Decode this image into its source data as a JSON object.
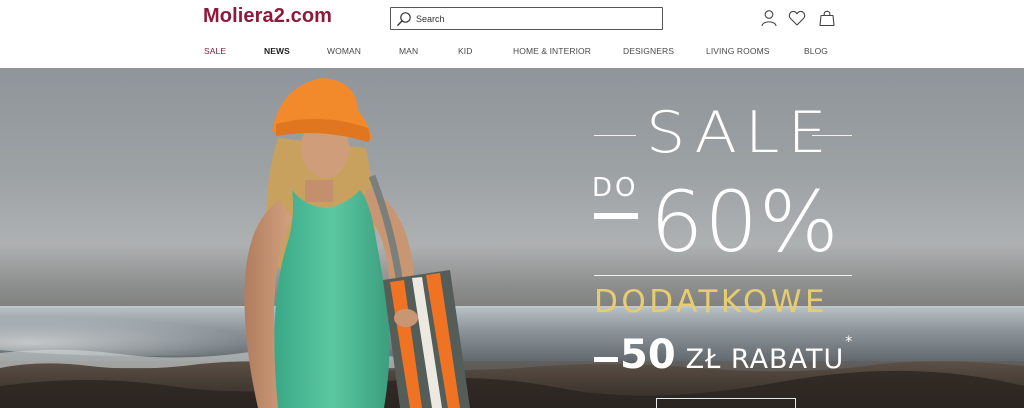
{
  "header": {
    "logo": "Moliera2.com",
    "search": {
      "placeholder": "Search",
      "value": ""
    },
    "icons": [
      "user-icon",
      "heart-icon",
      "shopping-bag-icon"
    ]
  },
  "nav": [
    {
      "label": "SALE",
      "key": "sale"
    },
    {
      "label": "NEWS",
      "key": "news"
    },
    {
      "label": "WOMAN",
      "key": "woman"
    },
    {
      "label": "MAN",
      "key": "man"
    },
    {
      "label": "KID",
      "key": "kid"
    },
    {
      "label": "HOME & INTERIOR",
      "key": "home-interior"
    },
    {
      "label": "DESIGNERS",
      "key": "designers"
    },
    {
      "label": "LIVING ROOMS",
      "key": "living-rooms"
    },
    {
      "label": "BLOG",
      "key": "blog"
    }
  ],
  "hero": {
    "title": "SALE",
    "do_label": "DO",
    "discount": "60%",
    "extra_label": "DODATKOWE",
    "extra_amount": "50",
    "extra_unit": "ZŁ RABATU",
    "footnote_mark": "*"
  },
  "colors": {
    "brand": "#8e1a3b",
    "accent_gold": "#e7cd6f",
    "nav_text": "#4a4a4a"
  }
}
